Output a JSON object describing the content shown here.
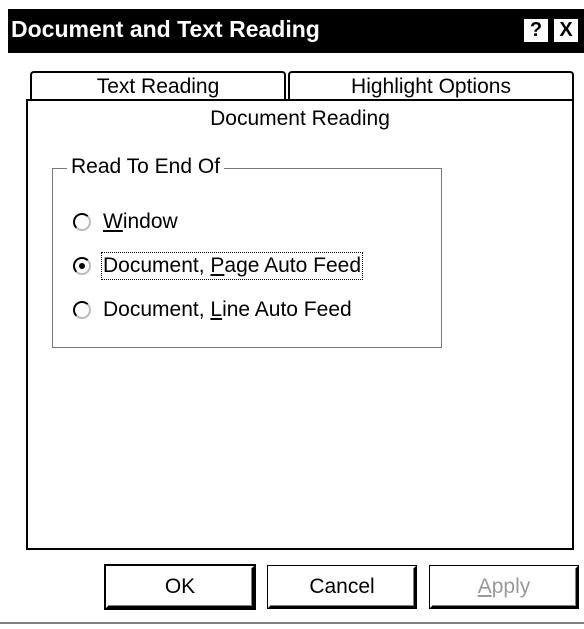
{
  "window": {
    "title": "Document and Text Reading",
    "help_label": "?",
    "close_label": "X"
  },
  "tabs": [
    {
      "label": "Text Reading"
    },
    {
      "label": "Highlight Options"
    }
  ],
  "panel": {
    "title": "Document Reading",
    "group": {
      "legend": "Read To End Of",
      "options": [
        {
          "label_prefix": "",
          "underline": "W",
          "label_suffix": "indow",
          "checked": false
        },
        {
          "label_prefix": "Document, ",
          "underline": "P",
          "label_suffix": "age Auto Feed",
          "checked": true
        },
        {
          "label_prefix": "Document, ",
          "underline": "L",
          "label_suffix": "ine Auto Feed",
          "checked": false
        }
      ]
    }
  },
  "buttons": {
    "ok": "OK",
    "cancel": "Cancel",
    "apply_underline": "A",
    "apply_rest": "pply"
  }
}
